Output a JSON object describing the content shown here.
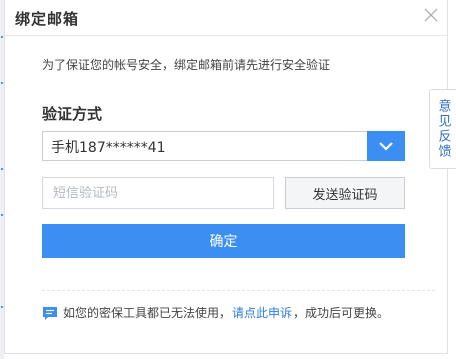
{
  "dialog": {
    "title": "绑定邮箱",
    "close_icon": "close-icon",
    "notice": "为了保证您的帐号安全，绑定邮箱前请先进行安全验证",
    "verify_label": "验证方式",
    "verify_method": {
      "selected": "手机187******41",
      "dropdown_icon": "chevron-down-icon"
    },
    "sms_code": {
      "placeholder": "短信验证码",
      "value": ""
    },
    "send_code_label": "发送验证码",
    "confirm_label": "确定",
    "tip": {
      "icon": "message-icon",
      "before": "如您的密保工具都已无法使用，",
      "link": "请点此申诉",
      "after": "，成功后可更换。"
    }
  },
  "feedback_tab": {
    "label": "意见反馈"
  },
  "colors": {
    "primary": "#3b8ff2",
    "link": "#2f7de1",
    "text": "#333333",
    "border": "#c9ced6"
  }
}
